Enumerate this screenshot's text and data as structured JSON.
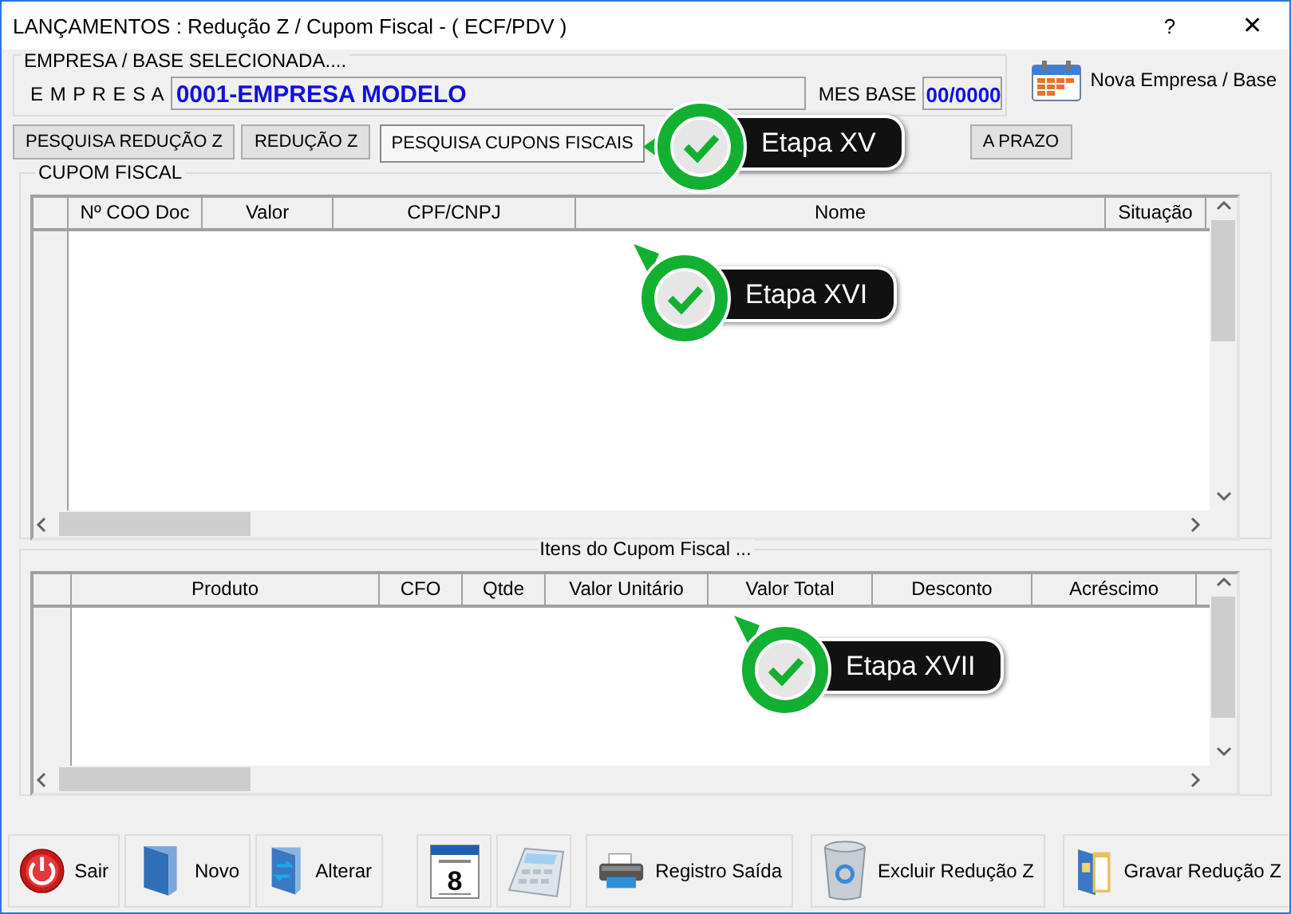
{
  "window": {
    "title": "LANÇAMENTOS : Redução Z / Cupom Fiscal - ( ECF/PDV )",
    "help": "?",
    "close": "✕"
  },
  "company": {
    "legend": "EMPRESA  /  BASE  SELECIONADA....",
    "label": "E M P R E S A",
    "value": "0001-EMPRESA MODELO",
    "month_label": "MES BASE",
    "month_value": "00/0000",
    "change_button": "Nova Empresa / Base"
  },
  "tabs": [
    {
      "label": "PESQUISA REDUÇÃO Z",
      "selected": false
    },
    {
      "label": "REDUÇÃO Z",
      "selected": false
    },
    {
      "label": "PESQUISA CUPONS FISCAIS",
      "selected": true
    },
    {
      "label": "A PRAZO",
      "selected": false
    }
  ],
  "coupon_grid": {
    "legend": "CUPOM FISCAL",
    "columns": [
      "Nº COO Doc",
      "Valor",
      "CPF/CNPJ",
      "Nome",
      "Situação"
    ]
  },
  "items_grid": {
    "legend": "Itens do Cupom Fiscal ...",
    "columns": [
      "Produto",
      "CFO",
      "Qtde",
      "Valor Unitário",
      "Valor Total",
      "Desconto",
      "Acréscimo"
    ]
  },
  "buttons": [
    {
      "kind": "power",
      "label": "Sair"
    },
    {
      "kind": "new",
      "label": "Novo"
    },
    {
      "kind": "edit",
      "label": "Alterar"
    },
    {
      "kind": "calendar",
      "day": "8"
    },
    {
      "kind": "calculator"
    },
    {
      "kind": "printer",
      "label": "Registro Saída"
    },
    {
      "kind": "trash",
      "label": "Excluir Redução Z"
    },
    {
      "kind": "save",
      "label": "Gravar Redução Z"
    }
  ],
  "callouts": [
    {
      "label": "Etapa XV",
      "kind": "side"
    },
    {
      "label": "Etapa XVI",
      "kind": "corner"
    },
    {
      "label": "Etapa XVII",
      "kind": "corner"
    }
  ]
}
